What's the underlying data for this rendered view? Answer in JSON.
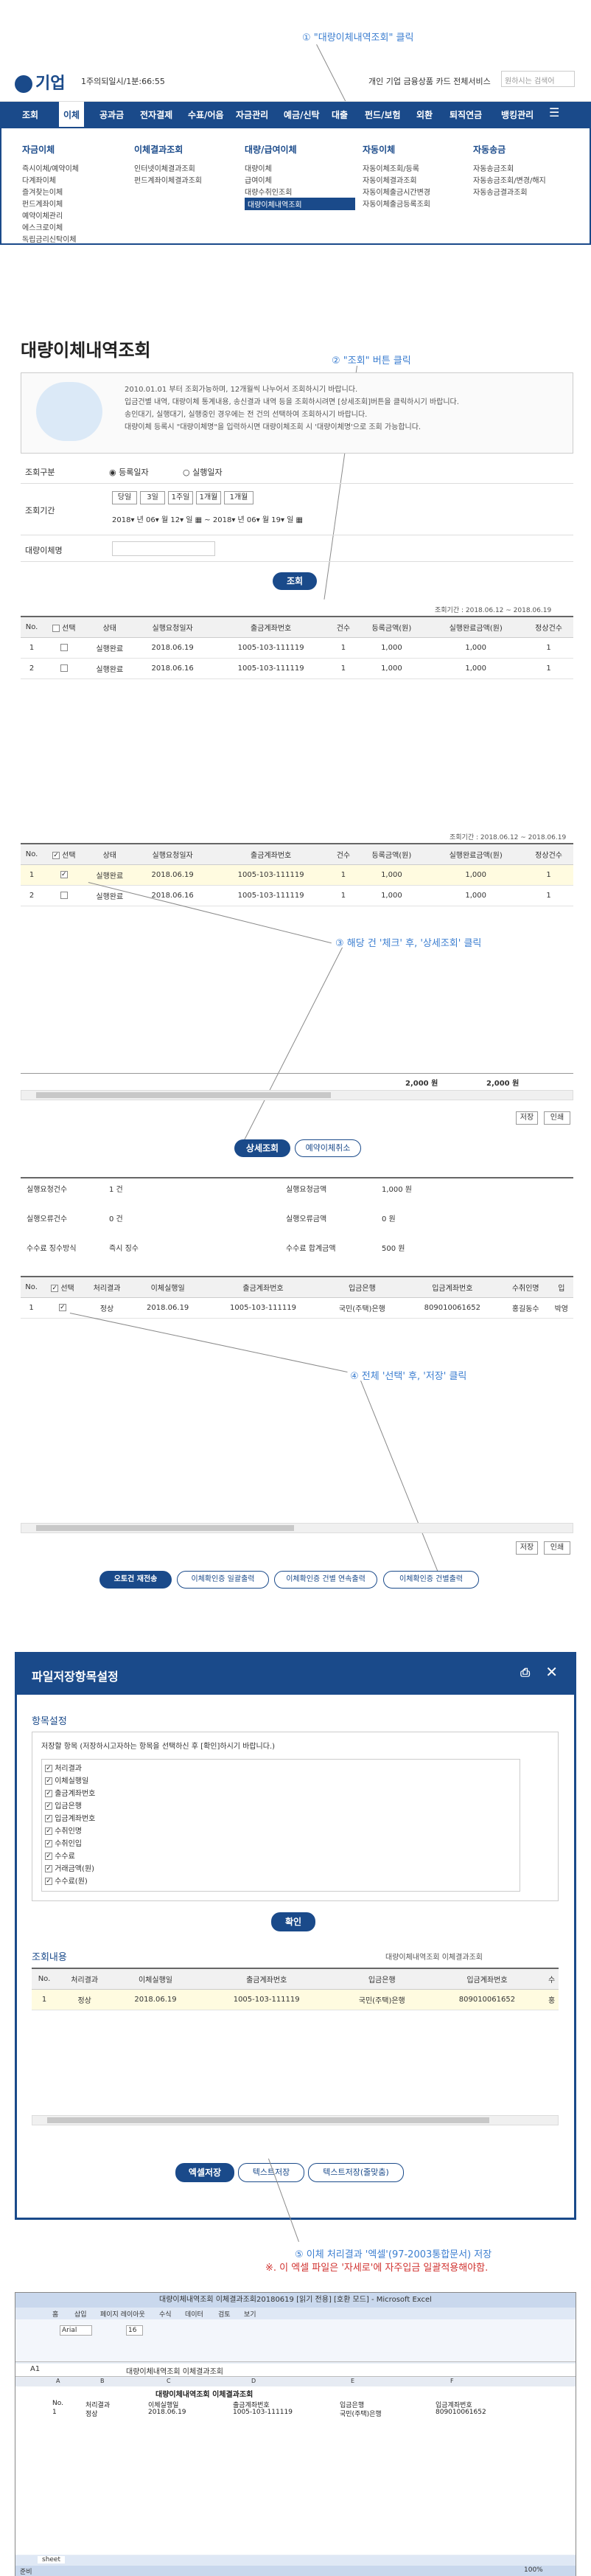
{
  "annotations": {
    "step1": "① \"대량이체내역조회\" 클릭",
    "step2": "② \"조회\" 버튼 클릭",
    "step3": "③ 해당 건 '체크' 후, '상세조회' 클릭",
    "step4": "④ 전체 '선택' 후, '저장' 클릭",
    "step5": "⑤ 이체 처리결과 '엑셀'(97-2003통합문서) 저장",
    "step5note": "※. 이 엑셀 파일은 '자세로'에 자주입금 일괄적용해야함."
  },
  "header": {
    "logo": "기업",
    "user": "1주의되일시/1분:66:55",
    "links": "개인 기업 금융상품 카드 전체서비스",
    "search_placeholder": "원하시는 검색어"
  },
  "gnb": [
    "조회",
    "이체",
    "공과금",
    "전자결제",
    "수표/어음",
    "자금관리",
    "예금/신탁",
    "대출",
    "펀드/보험",
    "외환",
    "퇴직연금",
    "뱅킹관리"
  ],
  "mega": {
    "cols": [
      {
        "head": "자금이체",
        "items": [
          "즉시이체/예약이체",
          "다계좌이체",
          "즐겨찾는이체",
          "펀드계좌이체",
          "예약이체관리",
          "에스크로이체",
          "독립금리신탁이체"
        ]
      },
      {
        "head": "이체결과조회",
        "items": [
          "인터넷이체결과조회",
          "펀드계좌이체결과조회"
        ]
      },
      {
        "head": "대량/급여이체",
        "items": [
          "대량이체",
          "급여이체",
          "대량수취인조회",
          "대량이체내역조회"
        ]
      },
      {
        "head": "자동이체",
        "items": [
          "자동이체조회/등록",
          "자동이체결과조회",
          "자동이체출금시간변경",
          "자동이체출금등록조회"
        ]
      },
      {
        "head": "자동송금",
        "items": [
          "자동송금조회",
          "자동송금조회/변경/해지",
          "자동송금결과조회"
        ]
      }
    ]
  },
  "page": {
    "title": "대량이체내역조회",
    "info": [
      "2010.01.01 부터 조회가능하며, 12개월씩 나누어서 조회하시기 바랍니다.",
      "입금건별 내역, 대량이체 통계내용, 송신결과 내역 등을 조회하시려면 [상세조회]버튼을 클릭하시기 바랍니다.",
      "송인대기, 실행대기, 실행중인 경우에는 전 건의 선택하여 조회하시기 바랍니다.",
      "대량이체 등록시 \"대량이체명\"을 입력하시면 대량이체조회 시 '대량이체명'으로 조회 가능합니다."
    ]
  },
  "form": {
    "label_type": "조회구분",
    "opt1": "등록일자",
    "opt2": "실행일자",
    "label_period": "조회기간",
    "quick": [
      "당일",
      "3일",
      "1주일",
      "1개월",
      "1개월"
    ],
    "from_y": "2018",
    "from_m": "06",
    "from_d": "12",
    "to_y": "2018",
    "to_m": "06",
    "to_d": "19",
    "label_name": "대량이체명",
    "search_btn": "조회",
    "period_text": "조회기간 : 2018.06.12 ~ 2018.06.19"
  },
  "list": {
    "headers": [
      "No.",
      "선택",
      "상태",
      "실행요청일자",
      "출금계좌번호",
      "건수",
      "등록금액(원)",
      "실행완료금액(원)",
      "정상건수"
    ],
    "rows": [
      [
        "1",
        "",
        "실행완료",
        "2018.06.19",
        "1005-103-111119",
        "1",
        "1,000",
        "1,000",
        "1"
      ],
      [
        "2",
        "",
        "실행완료",
        "2018.06.16",
        "1005-103-111119",
        "1",
        "1,000",
        "1,000",
        "1"
      ]
    ],
    "total1": "2,000 원",
    "total2": "2,000 원",
    "save": "저장",
    "print": "인쇄",
    "detail_btn": "상세조회",
    "cancel_btn": "예약이체취소"
  },
  "summary": [
    [
      "실행요청건수",
      "1 건",
      "실행요청금액",
      "1,000 원"
    ],
    [
      "실행오류건수",
      "0 건",
      "실행오류금액",
      "0 원"
    ],
    [
      "수수료 징수방식",
      "즉시 징수",
      "수수료 합계금액",
      "500 원"
    ]
  ],
  "detail": {
    "headers": [
      "No.",
      "선택",
      "처리결과",
      "이체실행일",
      "출금계좌번호",
      "입금은행",
      "입금계좌번호",
      "수취인명",
      "입"
    ],
    "row": [
      "1",
      "",
      "정상",
      "2018.06.19",
      "1005-103-111119",
      "국민(주택)은행",
      "809010061652",
      "홍길동수",
      "박영"
    ],
    "save": "저장",
    "print": "인쇄",
    "btns": [
      "오토건 재전송",
      "이체확인증 일괄출력",
      "이체확인증 건별 연속출력",
      "이체확인증 건별출력"
    ]
  },
  "modal": {
    "title": "파일저장항목설정",
    "section1": "항목설정",
    "hint": "저장할 항목 (저장하시고자하는 항목을 선택하신 후 [확인]하시기 바랍니다.)",
    "items": [
      "처리결과",
      "이체실행일",
      "출금계좌번호",
      "입금은행",
      "입금계좌번호",
      "수취인명",
      "수취인입",
      "수수료",
      "거래금액(원)",
      "수수료(원)"
    ],
    "ok": "확인",
    "section2": "조회내용",
    "caption": "대량이체내역조회 이체결과조회",
    "headers": [
      "No.",
      "처리결과",
      "이체실행일",
      "출금계좌번호",
      "입금은행",
      "입금계좌번호",
      "수"
    ],
    "row": [
      "1",
      "정상",
      "2018.06.19",
      "1005-103-111119",
      "국민(주택)은행",
      "809010061652",
      "홍"
    ],
    "btns": [
      "엑셀저장",
      "텍스트저장",
      "텍스트저장(줄맞춤)"
    ]
  },
  "excel": {
    "title": "대량이체내역조회 이체결과조회20180619 [읽기 전용] [호환 모드] - Microsoft Excel",
    "tabs": [
      "홈",
      "삽입",
      "페이지 레이아웃",
      "수식",
      "데이터",
      "검토",
      "보기"
    ],
    "cellref": "A1",
    "formula": "대량이체내역조회 이체결과조회",
    "font": "Arial",
    "fontsize": "16",
    "cols": [
      "A",
      "B",
      "C",
      "D",
      "E",
      "F"
    ],
    "header": [
      "No.",
      "처리결과",
      "이체실행일",
      "출금계좌번호",
      "입금은행",
      "입금계좌번호"
    ],
    "row": [
      "1",
      "정상",
      "2018.06.19",
      "1005-103-111119",
      "국민(주택)은행",
      "809010061652"
    ],
    "sheet": "sheet",
    "status": "준비",
    "zoom": "100%"
  }
}
